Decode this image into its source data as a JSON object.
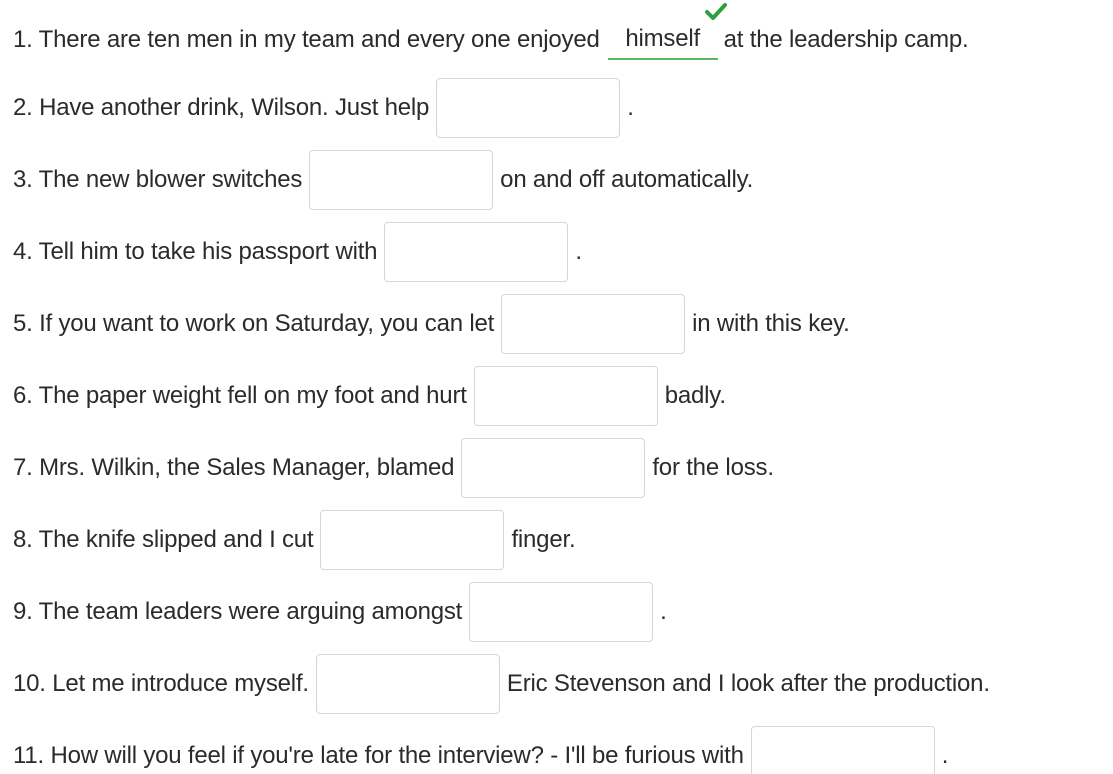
{
  "exercise": {
    "accent_correct": "#5cb85c",
    "items": [
      {
        "before": "1. There are ten men in my team and every one enjoyed",
        "answer": "himself",
        "after": "at the leadership camp.",
        "status": "correct"
      },
      {
        "before": "2. Have another drink, Wilson. Just help",
        "answer": "",
        "after": "."
      },
      {
        "before": "3. The new blower switches",
        "answer": "",
        "after": "on and off automatically."
      },
      {
        "before": "4. Tell him to take his passport with",
        "answer": "",
        "after": "."
      },
      {
        "before": "5. If you want to work on Saturday, you can let",
        "answer": "",
        "after": "in with this key."
      },
      {
        "before": "6. The paper weight fell on my foot and hurt",
        "answer": "",
        "after": "badly."
      },
      {
        "before": "7. Mrs. Wilkin, the Sales Manager, blamed",
        "answer": "",
        "after": "for the loss."
      },
      {
        "before": "8. The knife slipped and I cut",
        "answer": "",
        "after": "finger."
      },
      {
        "before": "9. The team leaders were arguing amongst",
        "answer": "",
        "after": "."
      },
      {
        "before": "10. Let me introduce myself.",
        "answer": "",
        "after": "Eric Stevenson and I look after the production."
      },
      {
        "before": "11. How will you feel if you're late for the interview? - I'll be furious with",
        "answer": "",
        "after": "."
      }
    ]
  }
}
